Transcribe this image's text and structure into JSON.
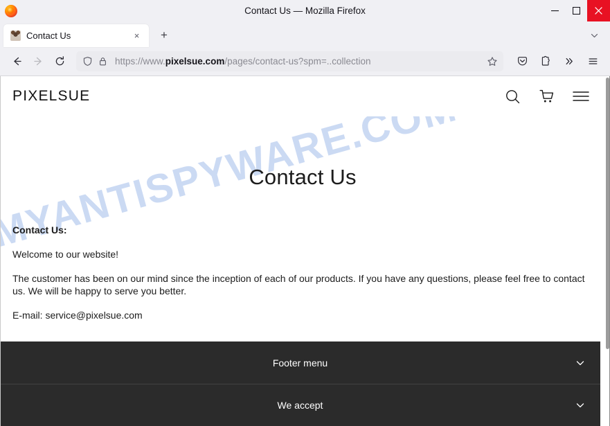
{
  "window": {
    "title": "Contact Us — Mozilla Firefox",
    "minimize_label": "minimize",
    "maximize_label": "maximize",
    "close_label": "close"
  },
  "tabs": {
    "items": [
      {
        "title": "Contact Us",
        "close_label": "×",
        "favicon": "site-favicon"
      }
    ],
    "new_tab_label": "+",
    "list_all_tabs_label": "list-all-tabs"
  },
  "toolbar": {
    "back_label": "back",
    "forward_label": "forward",
    "reload_label": "reload",
    "shield_label": "tracking-protection",
    "lock_label": "connection-secure",
    "url_scheme": "https://www.",
    "url_host": "pixelsue.com",
    "url_path": "/pages/contact-us?spm=..collection",
    "url_full": "https://www.pixelsue.com/pages/contact-us?spm=..collection",
    "bookmark_label": "bookmark-this-page",
    "pocket_label": "save-to-pocket",
    "extensions_label": "extensions",
    "overflow_label": "»",
    "appmenu_label": "open-application-menu"
  },
  "site": {
    "brand": "PIXELSUE",
    "header_icons": [
      {
        "name": "search-icon",
        "label": "Search"
      },
      {
        "name": "cart-icon",
        "label": "Cart"
      },
      {
        "name": "menu-icon",
        "label": "Menu"
      }
    ],
    "watermark": "MYANTISPYWARE.COM",
    "watermark_color": "#c3d4f2",
    "heading": "Contact Us",
    "paragraphs": [
      "Contact Us:",
      "Welcome to our website!",
      "The customer has been on our mind since the inception of each of our products. If you have any questions, please feel free to contact us. We will be happy to serve you better.",
      "E-mail: service@pixelsue.com"
    ],
    "footer": {
      "background": "#2b2b2b",
      "rows": [
        {
          "label": "Footer menu",
          "icon": "chevron-down-icon"
        },
        {
          "label": "We accept",
          "icon": "chevron-down-icon"
        }
      ]
    }
  }
}
